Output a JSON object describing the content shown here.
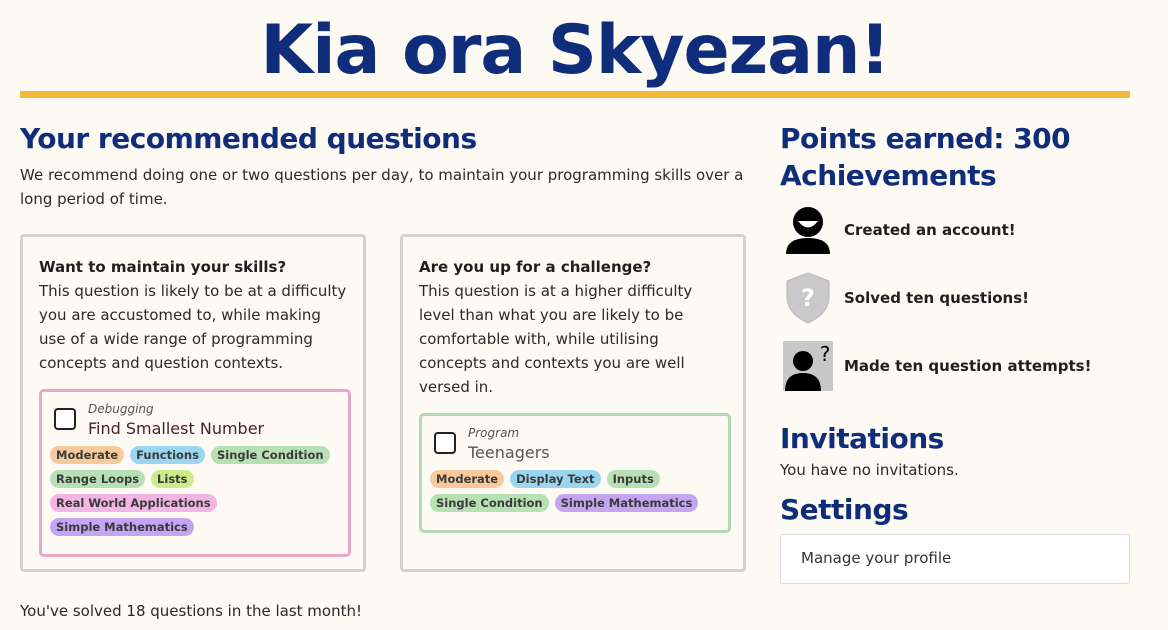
{
  "header": {
    "title": "Kia ora Skyezan!"
  },
  "recommended": {
    "heading": "Your recommended questions",
    "intro": "We recommend doing one or two questions per day, to maintain your programming skills over a long period of time.",
    "cards": [
      {
        "heading": "Want to maintain your skills?",
        "body": "This question is likely to be at a difficulty you are accustomed to, while making use of a wide range of programming concepts and question contexts.",
        "question": {
          "type": "Debugging",
          "name": "Find Smallest Number",
          "tags": [
            "Moderate",
            "Functions",
            "Single Condition",
            "Range Loops",
            "Lists",
            "Real World Applications",
            "Simple Mathematics"
          ]
        }
      },
      {
        "heading": "Are you up for a challenge?",
        "body": "This question is at a higher difficulty level than what you are likely to be comfortable with, while utilising concepts and contexts you are well versed in.",
        "question": {
          "type": "Program",
          "name": "Teenagers",
          "tags": [
            "Moderate",
            "Display Text",
            "Inputs",
            "Single Condition",
            "Simple Mathematics"
          ]
        }
      }
    ],
    "solved_text": "You've solved 18 questions in the last month!"
  },
  "points": {
    "label": "Points earned: 300"
  },
  "achievements": {
    "heading": "Achievements",
    "items": [
      {
        "icon": "smiling-user-icon",
        "label": "Created an account!"
      },
      {
        "icon": "locked-shield-icon",
        "label": "Solved ten questions!"
      },
      {
        "icon": "mystery-user-icon",
        "label": "Made ten question attempts!"
      }
    ]
  },
  "invitations": {
    "heading": "Invitations",
    "text": "You have no invitations."
  },
  "settings": {
    "heading": "Settings",
    "profile_button": "Manage your profile"
  },
  "colors": {
    "brand": "#0f2d7a",
    "accent": "#f4b93b",
    "background": "#fdf9f3"
  }
}
